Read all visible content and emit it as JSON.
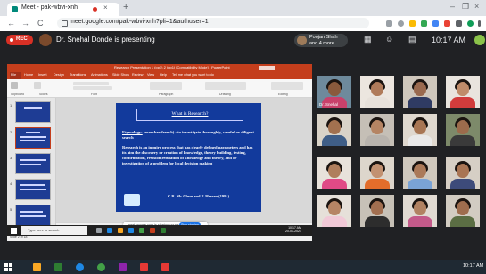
{
  "browser": {
    "tab_title": "Meet - pak-wbvi-xnh",
    "tab_close": "×",
    "new_tab": "+",
    "url": "meet.google.com/pak-wbvi-xnh?pli=1&authuser=1",
    "back": "←",
    "forward": "→",
    "reload": "C",
    "window_controls": [
      "–",
      "❐",
      "×"
    ]
  },
  "meet": {
    "rec_label": "REC",
    "presenting_text": "Dr. Snehal Donde is presenting",
    "joined_text": "Poojan Shah\nand 4 more",
    "time": "10:17 AM",
    "accent_color": "#d93025"
  },
  "powerpoint": {
    "title": "Research Presentation 1 (pp1) 2 (pp1)  [Compatibility Mode] - PowerPoint",
    "menu": [
      "File",
      "Home",
      "Insert",
      "Design",
      "Transitions",
      "Animations",
      "Slide Show",
      "Review",
      "View",
      "Help",
      "Tell me what you want to do"
    ],
    "ribbon_groups": [
      "Clipboard",
      "Slides",
      "Font",
      "Paragraph",
      "Drawing",
      "Editing"
    ],
    "thumb_numbers": [
      "1",
      "2",
      "3",
      "4",
      "5"
    ],
    "notes_placeholder": "Click to add notes",
    "status": "Slide 2 of 18",
    "notif_text": "meet.google.com is sharing your screen.",
    "stop_sharing": "Stop sharing"
  },
  "slide": {
    "title": "What is Research?",
    "etymology_label": "Etymology:",
    "etymology_text": " recercher(french) - to investigate thoroughly, careful or diligent search",
    "paragraph": "Research is an inquiry process that has clearly defined parameters  and has its aim the discovery or creation of knowledge, theory building, testing, confirmation, revision,refutation of knowledge and theory, and or investigation of a problem for local decision making",
    "citation": "C.R. Mc Clure and P. Hersen (1991)"
  },
  "presenter_taskbar": {
    "search_text": "Type here to search",
    "time": "10:17 AM\n20-01-2021"
  },
  "participants": [
    {
      "name": "Dr. Snehal",
      "face": "#8a5a3c",
      "body": "#c9416b",
      "bg": "#6e8a9c"
    },
    {
      "name": "",
      "face": "#b07b5a",
      "body": "#e7e1da",
      "bg": "#ece6df"
    },
    {
      "name": "",
      "face": "#9a6a4f",
      "body": "#2f3b63",
      "bg": "#cfc7bc"
    },
    {
      "name": "",
      "face": "#c08c6a",
      "body": "#d23c3c",
      "bg": "#e9e4de"
    },
    {
      "name": "",
      "face": "#a2714f",
      "body": "#3f5e87",
      "bg": "#d9d3c8"
    },
    {
      "name": "",
      "face": "#b58463",
      "body": "#b8b3ad",
      "bg": "#c5bfb6"
    },
    {
      "name": "",
      "face": "#a87654",
      "body": "#e9e9e9",
      "bg": "#dfd8cf"
    },
    {
      "name": "",
      "face": "#9c6b4c",
      "body": "#3a3a3a",
      "bg": "#7d8a6a"
    },
    {
      "name": "",
      "face": "#b07e5d",
      "body": "#e04a86",
      "bg": "#e8e2db"
    },
    {
      "name": "",
      "face": "#c29171",
      "body": "#e36d2b",
      "bg": "#ddd6cc"
    },
    {
      "name": "",
      "face": "#ab7a59",
      "body": "#7aa3d6",
      "bg": "#cfc8bd"
    },
    {
      "name": "",
      "face": "#a97554",
      "body": "#3d4b7a",
      "bg": "#d6cfc5"
    },
    {
      "name": "",
      "face": "#b68565",
      "body": "#f1c9d7",
      "bg": "#e6e0d9"
    },
    {
      "name": "",
      "face": "#a26f50",
      "body": "#2d2d2d",
      "bg": "#c7c1b7"
    },
    {
      "name": "",
      "face": "#b18262",
      "body": "#c35a8a",
      "bg": "#e0dad2"
    },
    {
      "name": "",
      "face": "#9e6d4e",
      "body": "#5b6e44",
      "bg": "#d2ccc2"
    }
  ],
  "windows_taskbar": {
    "time": "10:17 AM"
  }
}
